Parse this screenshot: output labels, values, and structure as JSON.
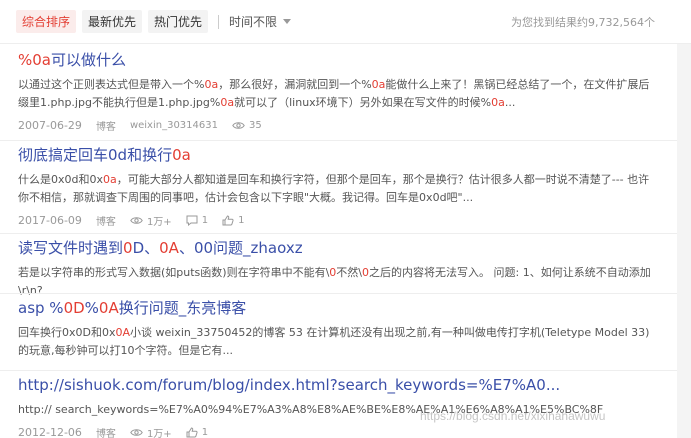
{
  "filter_bar": {
    "sort_options": [
      "综合排序",
      "最新优先",
      "热门优先"
    ],
    "active_index": 0,
    "time_filter": "时间不限",
    "result_count": "为您找到结果约9,732,564个"
  },
  "results": [
    {
      "title_parts": [
        {
          "t": "%0a",
          "hl": true
        },
        {
          "t": "可以做什么",
          "hl": false
        }
      ],
      "snippet_parts": [
        {
          "t": "以通过这个正则表达式但是带入一个%",
          "hl": false
        },
        {
          "t": "0a",
          "hl": true
        },
        {
          "t": "，那么很好，漏洞就回到一个%",
          "hl": false
        },
        {
          "t": "0a",
          "hl": true
        },
        {
          "t": "能做什么上来了！黑锅已经总结了一个，在文件扩展后缀里1.php.jpg不能执行但是1.php.jpg%",
          "hl": false
        },
        {
          "t": "0a",
          "hl": true
        },
        {
          "t": "就可以了（linux环境下）另外如果在写文件的时候%",
          "hl": false
        },
        {
          "t": "0a",
          "hl": true
        },
        {
          "t": "...",
          "hl": false
        }
      ],
      "date": "2007-06-29",
      "source_label": "博客",
      "author": "weixin_30314631",
      "views": "35"
    },
    {
      "title_parts": [
        {
          "t": "彻底搞定回车0d和换行",
          "hl": false
        },
        {
          "t": "0a",
          "hl": true
        }
      ],
      "snippet_parts": [
        {
          "t": "什么是0x0d和0x",
          "hl": false
        },
        {
          "t": "0a",
          "hl": true
        },
        {
          "t": "，可能大部分人都知道是回车和换行字符，但那个是回车，那个是换行？估计很多人都一时说不清楚了--- 也许你不相信，那就调查下周围的同事吧，估计会包含以下字眼\"大概。我记得。回车是0x0d吧\"...",
          "hl": false
        }
      ],
      "date": "2017-06-09",
      "source_label": "博客",
      "views": "1万+",
      "comments": "1",
      "likes": "1"
    },
    {
      "title_parts": [
        {
          "t": "读写文件时遇到",
          "hl": false
        },
        {
          "t": "0",
          "hl": true
        },
        {
          "t": "D、",
          "hl": false
        },
        {
          "t": "0A",
          "hl": true
        },
        {
          "t": "、00问题_zhaoxz",
          "hl": false
        }
      ],
      "snippet_parts": [
        {
          "t": "若是以字符串的形式写入数据(如puts函数)则在字符串中不能有\\",
          "hl": false
        },
        {
          "t": "0",
          "hl": true
        },
        {
          "t": "不然\\",
          "hl": false
        },
        {
          "t": "0",
          "hl": true
        },
        {
          "t": "之后的内容将无法写入。 问题: 1、如何让系统不自动添加\\r\\n?",
          "hl": false
        }
      ]
    },
    {
      "title_parts": [
        {
          "t": "asp %",
          "hl": false
        },
        {
          "t": "0D",
          "hl": true
        },
        {
          "t": "%",
          "hl": false
        },
        {
          "t": "0A",
          "hl": true
        },
        {
          "t": "换行问题_东亮博客",
          "hl": false
        }
      ],
      "snippet_parts": [
        {
          "t": "回车换行0x0D和0x",
          "hl": false
        },
        {
          "t": "0A",
          "hl": true
        },
        {
          "t": "小谈 weixin_33750452的博客 53 在计算机还没有出现之前,有一种叫做电传打字机(Teletype Model 33)的玩意,每秒钟可以打10个字符。但是它有...",
          "hl": false
        }
      ]
    },
    {
      "title_parts": [
        {
          "t": "http://sishuok.com/forum/blog/index.html?search_keywords=%E7%A0...",
          "hl": false
        }
      ],
      "snippet_parts": [
        {
          "t": "http:// search_keywords=%E7%A0%94%E7%A3%A8%E8%AE%BE%E8%AE%A1%E6%A8%A1%E5%BC%8F",
          "hl": false
        }
      ],
      "date": "2012-12-06",
      "source_label": "博客",
      "views": "1万+",
      "likes": "1"
    }
  ],
  "watermark": "https://blog.csdn.net/xixihahawuwu",
  "colors": {
    "accent": "#e33e33",
    "title": "#3a4fa8"
  }
}
